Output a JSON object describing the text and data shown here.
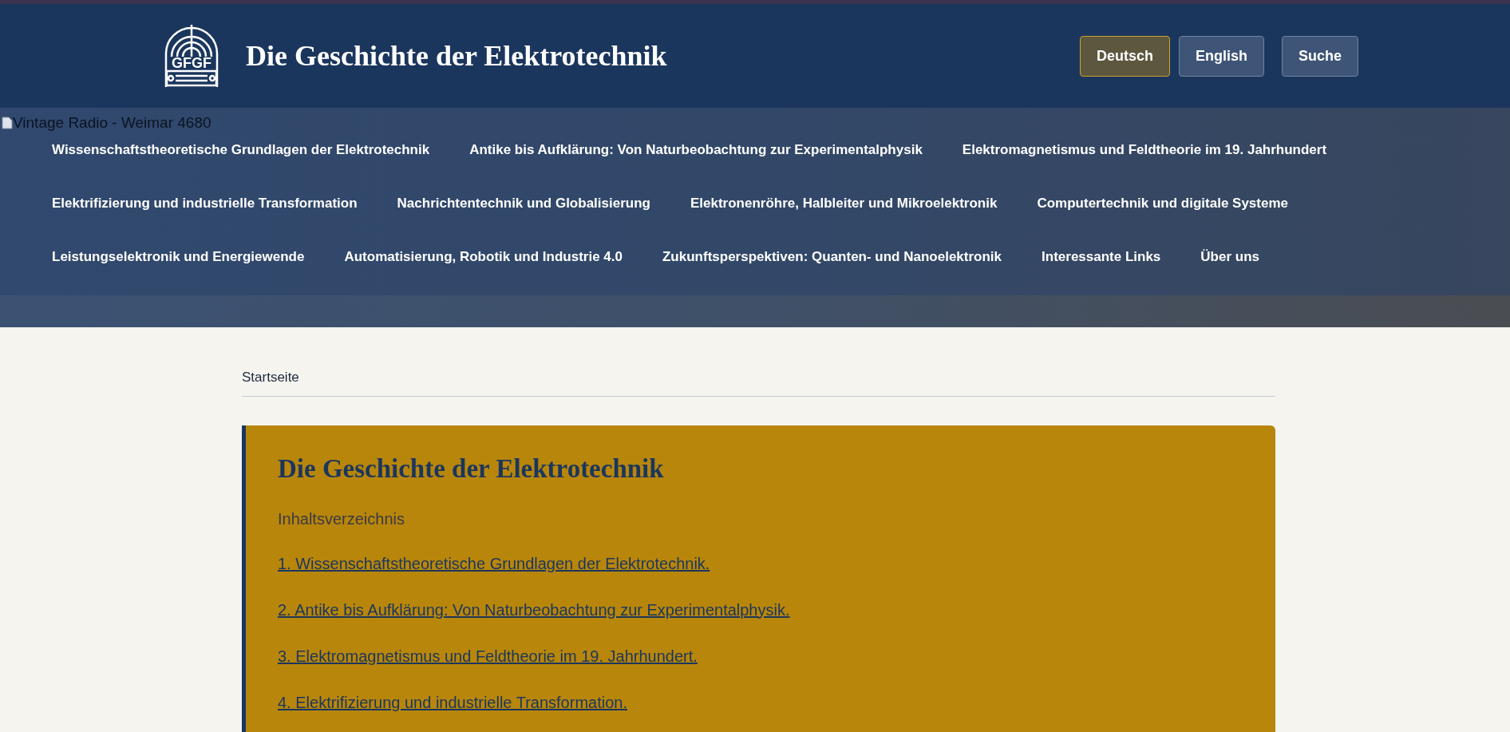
{
  "header": {
    "logo_text": "GFGF",
    "title": "Die Geschichte der Elektrotechnik",
    "buttons": [
      {
        "label": "Deutsch",
        "kind": "language",
        "selected": true
      },
      {
        "label": "English",
        "kind": "language",
        "selected": false
      },
      {
        "label": "Suche",
        "kind": "search",
        "selected": false
      }
    ]
  },
  "hero": {
    "image_alt": "Vintage Radio - Weimar 4680",
    "nav": [
      "Wissenschaftstheoretische Grundlagen der Elektrotechnik",
      "Antike bis Aufklärung: Von Naturbeobachtung zur Experimentalphysik",
      "Elektromagnetismus und Feldtheorie im 19. Jahrhundert",
      "Elektrifizierung und industrielle Transformation",
      "Nachrichtentechnik und Globalisierung",
      "Elektronenröhre, Halbleiter und Mikroelektronik",
      "Computertechnik und digitale Systeme",
      "Leistungselektronik und Energiewende",
      "Automatisierung, Robotik und Industrie 4.0",
      "Zukunftsperspektiven: Quanten- und Nanoelektronik",
      "Interessante Links",
      "Über uns"
    ]
  },
  "breadcrumb": "Startseite",
  "card": {
    "title": "Die Geschichte der Elektrotechnik",
    "subtitle": "Inhaltsverzeichnis",
    "links": [
      "1. Wissenschaftstheoretische Grundlagen der Elektrotechnik.",
      "2. Antike bis Aufklärung: Von Naturbeobachtung zur Experimentalphysik.",
      "3. Elektromagnetismus und Feldtheorie im 19. Jahrhundert.",
      "4. Elektrifizierung und industrielle Transformation."
    ]
  }
}
